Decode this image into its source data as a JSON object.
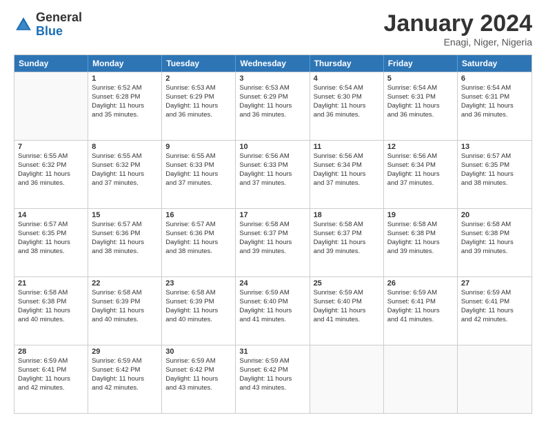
{
  "logo": {
    "general": "General",
    "blue": "Blue"
  },
  "title": "January 2024",
  "location": "Enagi, Niger, Nigeria",
  "days": [
    "Sunday",
    "Monday",
    "Tuesday",
    "Wednesday",
    "Thursday",
    "Friday",
    "Saturday"
  ],
  "rows": [
    [
      {
        "day": "",
        "empty": true
      },
      {
        "day": "1",
        "lines": [
          "Sunrise: 6:52 AM",
          "Sunset: 6:28 PM",
          "Daylight: 11 hours",
          "and 35 minutes."
        ]
      },
      {
        "day": "2",
        "lines": [
          "Sunrise: 6:53 AM",
          "Sunset: 6:29 PM",
          "Daylight: 11 hours",
          "and 36 minutes."
        ]
      },
      {
        "day": "3",
        "lines": [
          "Sunrise: 6:53 AM",
          "Sunset: 6:29 PM",
          "Daylight: 11 hours",
          "and 36 minutes."
        ]
      },
      {
        "day": "4",
        "lines": [
          "Sunrise: 6:54 AM",
          "Sunset: 6:30 PM",
          "Daylight: 11 hours",
          "and 36 minutes."
        ]
      },
      {
        "day": "5",
        "lines": [
          "Sunrise: 6:54 AM",
          "Sunset: 6:31 PM",
          "Daylight: 11 hours",
          "and 36 minutes."
        ]
      },
      {
        "day": "6",
        "lines": [
          "Sunrise: 6:54 AM",
          "Sunset: 6:31 PM",
          "Daylight: 11 hours",
          "and 36 minutes."
        ]
      }
    ],
    [
      {
        "day": "7",
        "lines": [
          "Sunrise: 6:55 AM",
          "Sunset: 6:32 PM",
          "Daylight: 11 hours",
          "and 36 minutes."
        ]
      },
      {
        "day": "8",
        "lines": [
          "Sunrise: 6:55 AM",
          "Sunset: 6:32 PM",
          "Daylight: 11 hours",
          "and 37 minutes."
        ]
      },
      {
        "day": "9",
        "lines": [
          "Sunrise: 6:55 AM",
          "Sunset: 6:33 PM",
          "Daylight: 11 hours",
          "and 37 minutes."
        ]
      },
      {
        "day": "10",
        "lines": [
          "Sunrise: 6:56 AM",
          "Sunset: 6:33 PM",
          "Daylight: 11 hours",
          "and 37 minutes."
        ]
      },
      {
        "day": "11",
        "lines": [
          "Sunrise: 6:56 AM",
          "Sunset: 6:34 PM",
          "Daylight: 11 hours",
          "and 37 minutes."
        ]
      },
      {
        "day": "12",
        "lines": [
          "Sunrise: 6:56 AM",
          "Sunset: 6:34 PM",
          "Daylight: 11 hours",
          "and 37 minutes."
        ]
      },
      {
        "day": "13",
        "lines": [
          "Sunrise: 6:57 AM",
          "Sunset: 6:35 PM",
          "Daylight: 11 hours",
          "and 38 minutes."
        ]
      }
    ],
    [
      {
        "day": "14",
        "lines": [
          "Sunrise: 6:57 AM",
          "Sunset: 6:35 PM",
          "Daylight: 11 hours",
          "and 38 minutes."
        ]
      },
      {
        "day": "15",
        "lines": [
          "Sunrise: 6:57 AM",
          "Sunset: 6:36 PM",
          "Daylight: 11 hours",
          "and 38 minutes."
        ]
      },
      {
        "day": "16",
        "lines": [
          "Sunrise: 6:57 AM",
          "Sunset: 6:36 PM",
          "Daylight: 11 hours",
          "and 38 minutes."
        ]
      },
      {
        "day": "17",
        "lines": [
          "Sunrise: 6:58 AM",
          "Sunset: 6:37 PM",
          "Daylight: 11 hours",
          "and 39 minutes."
        ]
      },
      {
        "day": "18",
        "lines": [
          "Sunrise: 6:58 AM",
          "Sunset: 6:37 PM",
          "Daylight: 11 hours",
          "and 39 minutes."
        ]
      },
      {
        "day": "19",
        "lines": [
          "Sunrise: 6:58 AM",
          "Sunset: 6:38 PM",
          "Daylight: 11 hours",
          "and 39 minutes."
        ]
      },
      {
        "day": "20",
        "lines": [
          "Sunrise: 6:58 AM",
          "Sunset: 6:38 PM",
          "Daylight: 11 hours",
          "and 39 minutes."
        ]
      }
    ],
    [
      {
        "day": "21",
        "lines": [
          "Sunrise: 6:58 AM",
          "Sunset: 6:38 PM",
          "Daylight: 11 hours",
          "and 40 minutes."
        ]
      },
      {
        "day": "22",
        "lines": [
          "Sunrise: 6:58 AM",
          "Sunset: 6:39 PM",
          "Daylight: 11 hours",
          "and 40 minutes."
        ]
      },
      {
        "day": "23",
        "lines": [
          "Sunrise: 6:58 AM",
          "Sunset: 6:39 PM",
          "Daylight: 11 hours",
          "and 40 minutes."
        ]
      },
      {
        "day": "24",
        "lines": [
          "Sunrise: 6:59 AM",
          "Sunset: 6:40 PM",
          "Daylight: 11 hours",
          "and 41 minutes."
        ]
      },
      {
        "day": "25",
        "lines": [
          "Sunrise: 6:59 AM",
          "Sunset: 6:40 PM",
          "Daylight: 11 hours",
          "and 41 minutes."
        ]
      },
      {
        "day": "26",
        "lines": [
          "Sunrise: 6:59 AM",
          "Sunset: 6:41 PM",
          "Daylight: 11 hours",
          "and 41 minutes."
        ]
      },
      {
        "day": "27",
        "lines": [
          "Sunrise: 6:59 AM",
          "Sunset: 6:41 PM",
          "Daylight: 11 hours",
          "and 42 minutes."
        ]
      }
    ],
    [
      {
        "day": "28",
        "lines": [
          "Sunrise: 6:59 AM",
          "Sunset: 6:41 PM",
          "Daylight: 11 hours",
          "and 42 minutes."
        ]
      },
      {
        "day": "29",
        "lines": [
          "Sunrise: 6:59 AM",
          "Sunset: 6:42 PM",
          "Daylight: 11 hours",
          "and 42 minutes."
        ]
      },
      {
        "day": "30",
        "lines": [
          "Sunrise: 6:59 AM",
          "Sunset: 6:42 PM",
          "Daylight: 11 hours",
          "and 43 minutes."
        ]
      },
      {
        "day": "31",
        "lines": [
          "Sunrise: 6:59 AM",
          "Sunset: 6:42 PM",
          "Daylight: 11 hours",
          "and 43 minutes."
        ]
      },
      {
        "day": "",
        "empty": true
      },
      {
        "day": "",
        "empty": true
      },
      {
        "day": "",
        "empty": true
      }
    ]
  ]
}
